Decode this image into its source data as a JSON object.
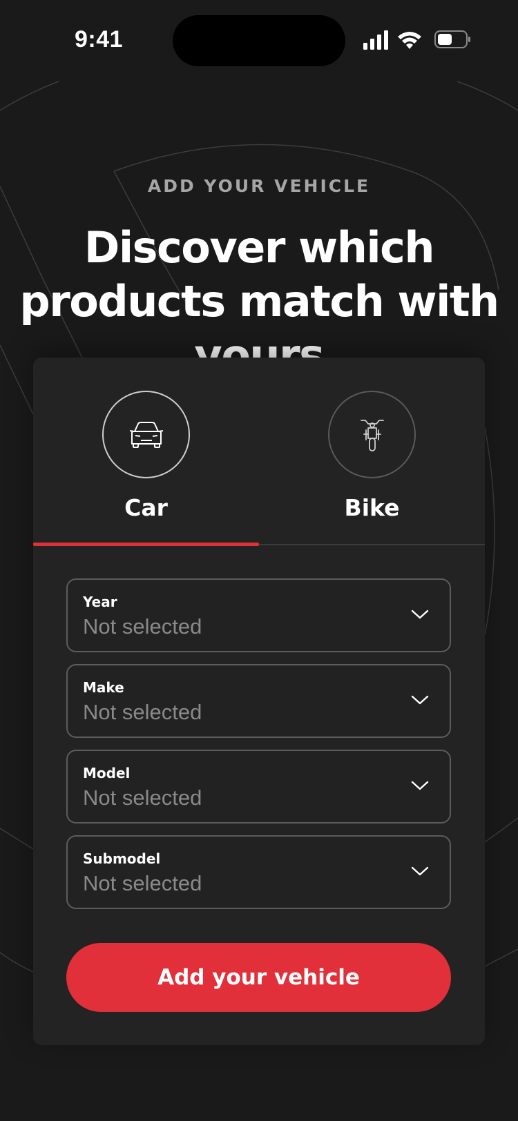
{
  "status_bar": {
    "time": "9:41"
  },
  "header": {
    "eyebrow": "ADD YOUR VEHICLE",
    "headline": "Discover which products match with yours"
  },
  "tabs": [
    {
      "label": "Car",
      "icon": "car-icon",
      "selected": true
    },
    {
      "label": "Bike",
      "icon": "motorcycle-icon",
      "selected": false
    }
  ],
  "form": {
    "fields": [
      {
        "label": "Year",
        "value": "Not selected"
      },
      {
        "label": "Make",
        "value": "Not selected"
      },
      {
        "label": "Model",
        "value": "Not selected"
      },
      {
        "label": "Submodel",
        "value": "Not selected"
      }
    ],
    "submit_label": "Add your vehicle"
  },
  "colors": {
    "background": "#1a1a1a",
    "card": "#232323",
    "accent": "#e2303a",
    "placeholder": "#8a8a8a"
  }
}
